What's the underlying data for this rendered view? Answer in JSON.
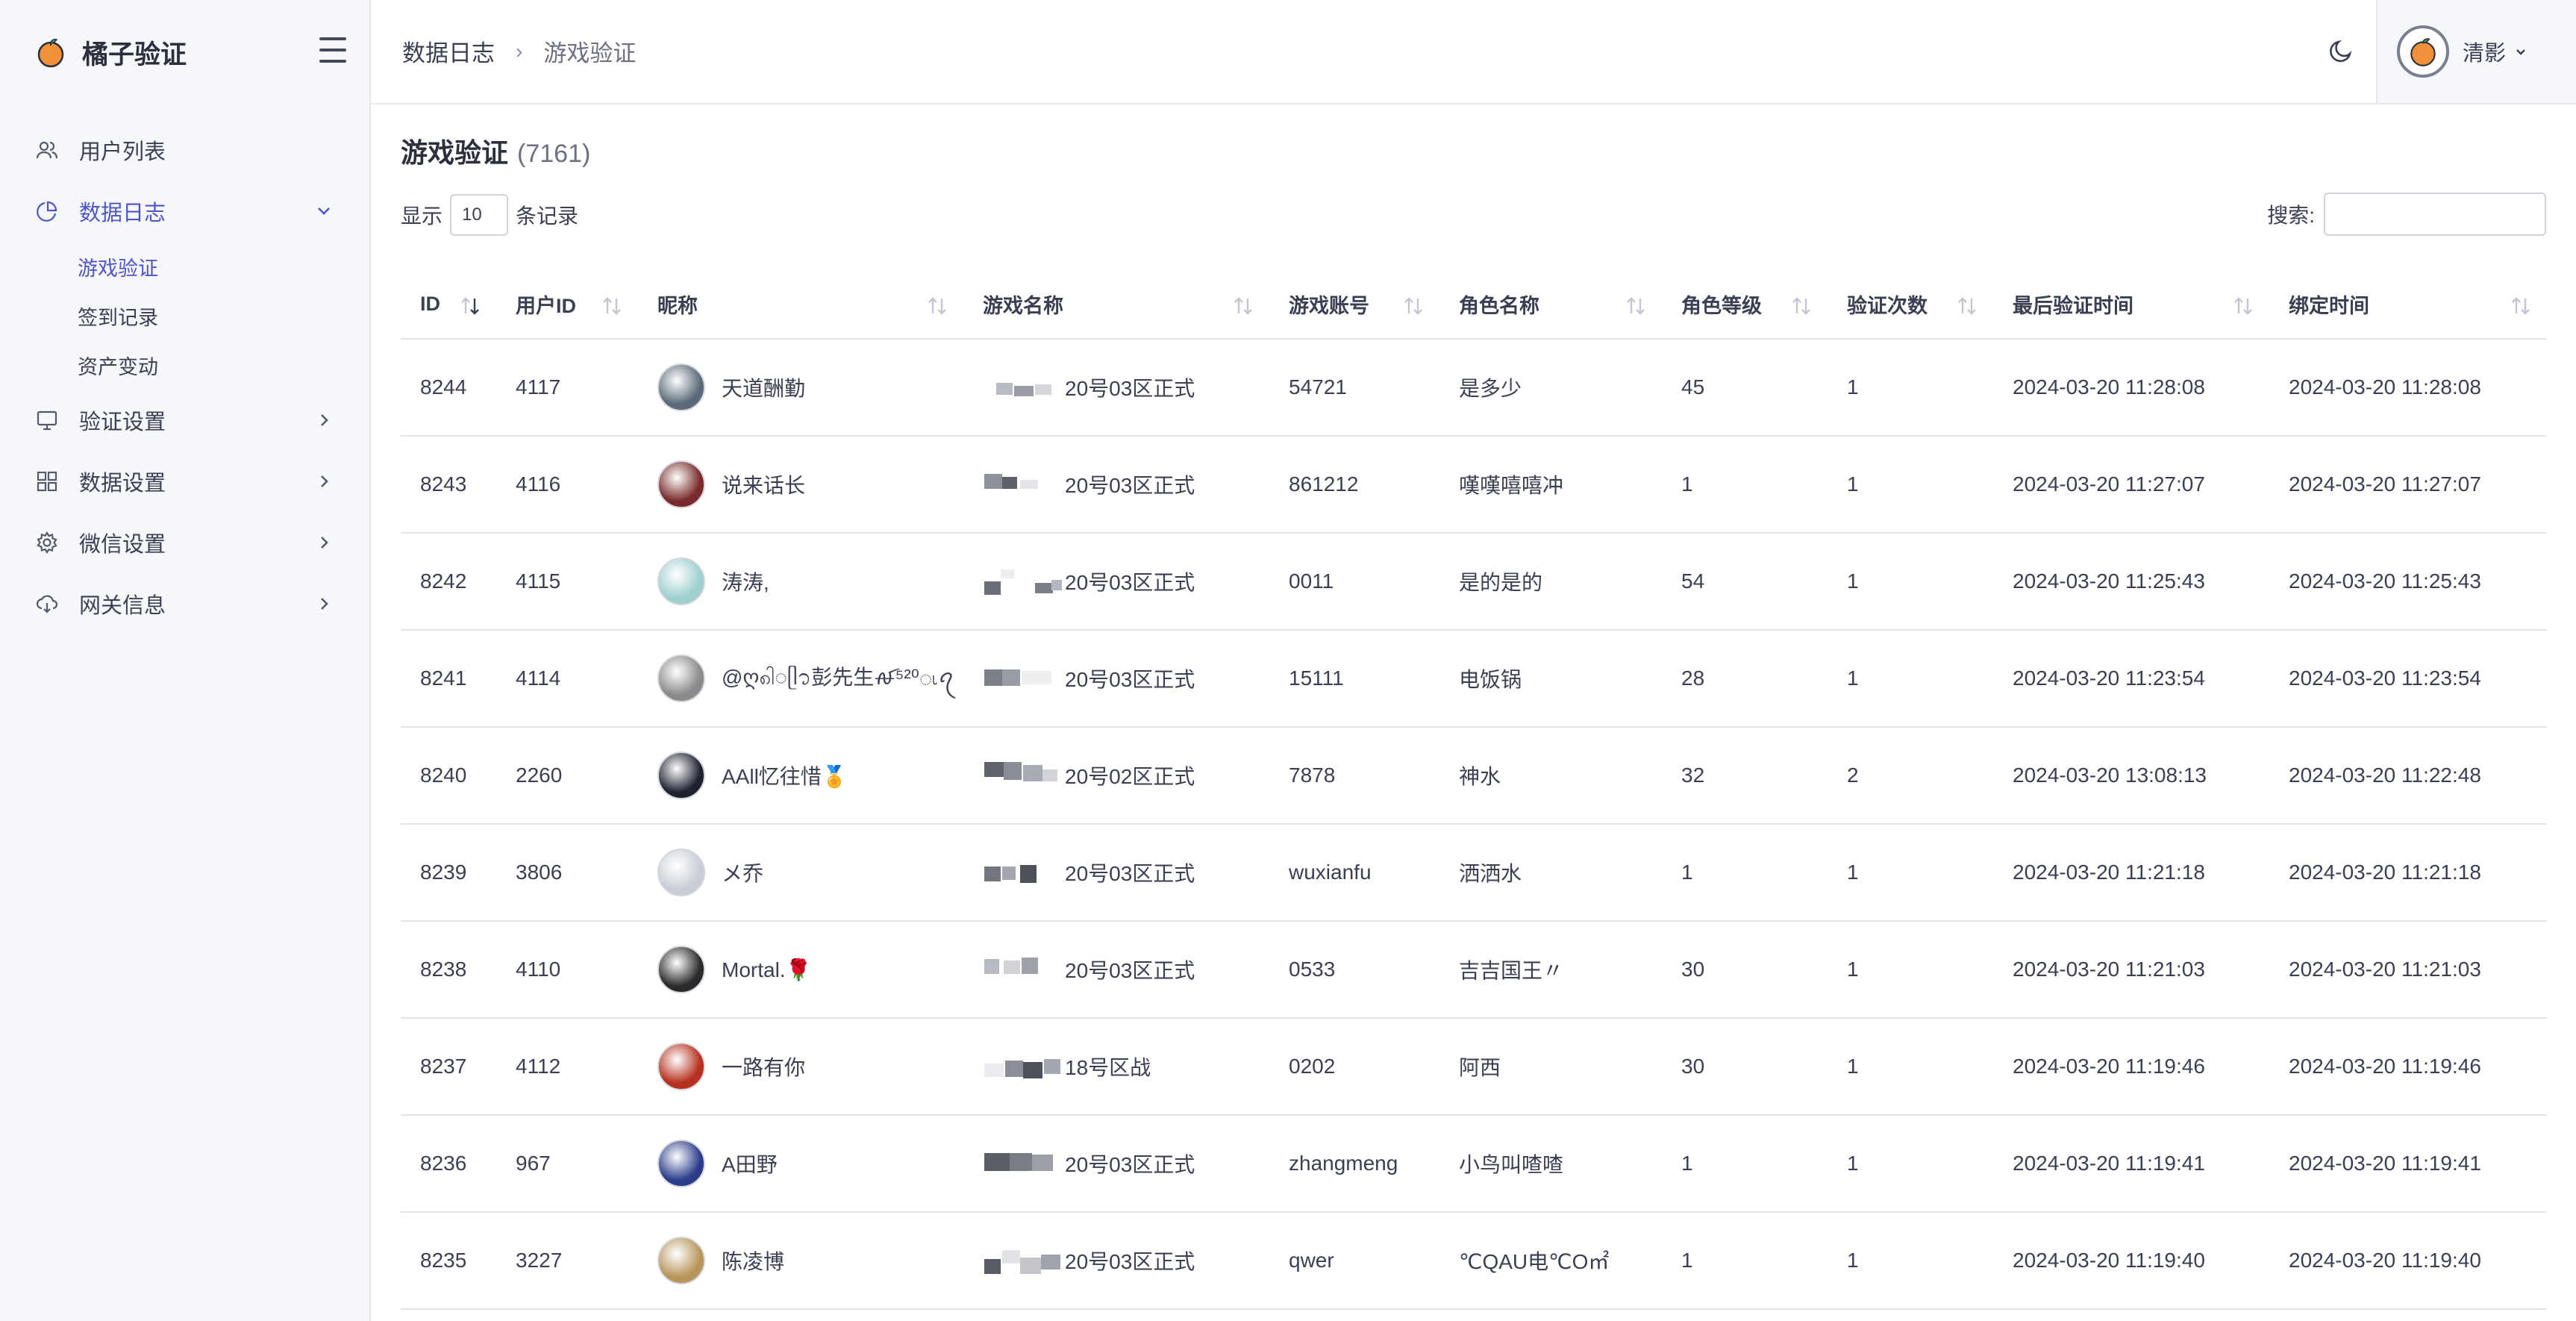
{
  "app": {
    "name": "橘子验证"
  },
  "sidebar": {
    "items": [
      {
        "key": "users",
        "label": "用户列表",
        "icon": "users-icon"
      },
      {
        "key": "logs",
        "label": "数据日志",
        "icon": "pie-chart-icon",
        "expanded": true,
        "children": [
          {
            "label": "游戏验证",
            "active": true
          },
          {
            "label": "签到记录"
          },
          {
            "label": "资产变动"
          }
        ]
      },
      {
        "key": "verify",
        "label": "验证设置",
        "icon": "monitor-icon"
      },
      {
        "key": "data",
        "label": "数据设置",
        "icon": "grid-icon"
      },
      {
        "key": "wechat",
        "label": "微信设置",
        "icon": "gear-icon"
      },
      {
        "key": "gateway",
        "label": "网关信息",
        "icon": "cloud-download-icon"
      }
    ]
  },
  "header": {
    "breadcrumb": [
      "数据日志",
      "游戏验证"
    ],
    "user": {
      "name": "清影"
    }
  },
  "main": {
    "title": "游戏验证",
    "count": "(7161)",
    "length": {
      "prefix": "显示",
      "value": "10",
      "suffix": "条记录"
    },
    "search": {
      "label": "搜索:",
      "value": ""
    }
  },
  "table": {
    "columns": [
      "ID",
      "用户ID",
      "昵称",
      "游戏名称",
      "游戏账号",
      "角色名称",
      "角色等级",
      "验证次数",
      "最后验证时间",
      "绑定时间"
    ],
    "rows": [
      {
        "id": "8244",
        "uid": "4117",
        "nick": "天道酬勤",
        "game": "20号03区正式",
        "account": "54721",
        "role": "是多少",
        "level": "45",
        "times": "1",
        "last": "2024-03-20 11:28:08",
        "bind": "2024-03-20 11:28:08",
        "avatar_color": "#5a6a78"
      },
      {
        "id": "8243",
        "uid": "4116",
        "nick": "说来话长",
        "game": "20号03区正式",
        "account": "861212",
        "role": "嘆嘆嘻嘻冲",
        "level": "1",
        "times": "1",
        "last": "2024-03-20 11:27:07",
        "bind": "2024-03-20 11:27:07",
        "avatar_color": "#7a2a2a"
      },
      {
        "id": "8242",
        "uid": "4115",
        "nick": "涛涛,",
        "game": "20号03区正式",
        "account": "0011",
        "role": "是的是的",
        "level": "54",
        "times": "1",
        "last": "2024-03-20 11:25:43",
        "bind": "2024-03-20 11:25:43",
        "avatar_color": "#9fcfcf"
      },
      {
        "id": "8241",
        "uid": "4114",
        "nick": "@ღ၈ါ◌ᥫ᭡彭先生ꫛ⁵²⁰ၬꪖ",
        "game": "20号03区正式",
        "account": "15111",
        "role": "电饭锅",
        "level": "28",
        "times": "1",
        "last": "2024-03-20 11:23:54",
        "bind": "2024-03-20 11:23:54",
        "avatar_color": "#8a8a8a"
      },
      {
        "id": "8240",
        "uid": "2260",
        "nick": "AAll忆往惜🏅",
        "game": "20号02区正式",
        "account": "7878",
        "role": "神水",
        "level": "32",
        "times": "2",
        "last": "2024-03-20 13:08:13",
        "bind": "2024-03-20 11:22:48",
        "avatar_color": "#1e2230"
      },
      {
        "id": "8239",
        "uid": "3806",
        "nick": "メ乔",
        "game": "20号03区正式",
        "account": "wuxianfu",
        "role": "洒洒水",
        "level": "1",
        "times": "1",
        "last": "2024-03-20 11:21:18",
        "bind": "2024-03-20 11:21:18",
        "avatar_color": "#c9ced6"
      },
      {
        "id": "8238",
        "uid": "4110",
        "nick": "Mortal.🌹",
        "game": "20号03区正式",
        "account": "0533",
        "role": "吉吉国王〃",
        "level": "30",
        "times": "1",
        "last": "2024-03-20 11:21:03",
        "bind": "2024-03-20 11:21:03",
        "avatar_color": "#2a2a2a"
      },
      {
        "id": "8237",
        "uid": "4112",
        "nick": "一路有你",
        "game": "18号区战",
        "account": "0202",
        "role": "阿西",
        "level": "30",
        "times": "1",
        "last": "2024-03-20 11:19:46",
        "bind": "2024-03-20 11:19:46",
        "avatar_color": "#b5301f"
      },
      {
        "id": "8236",
        "uid": "967",
        "nick": "A田野",
        "game": "20号03区正式",
        "account": "zhangmeng",
        "role": "小鸟叫喳喳",
        "level": "1",
        "times": "1",
        "last": "2024-03-20 11:19:41",
        "bind": "2024-03-20 11:19:41",
        "avatar_color": "#2b3d8a"
      },
      {
        "id": "8235",
        "uid": "3227",
        "nick": "陈凌博",
        "game": "20号03区正式",
        "account": "qwer",
        "role": "℃QAU电℃O㎡",
        "level": "1",
        "times": "1",
        "last": "2024-03-20 11:19:40",
        "bind": "2024-03-20 11:19:40",
        "avatar_color": "#b8955a"
      }
    ]
  },
  "colors": {
    "accent": "#4e55c7",
    "sidebar_bg": "#f6f7fb",
    "border": "#e3e5ec"
  }
}
